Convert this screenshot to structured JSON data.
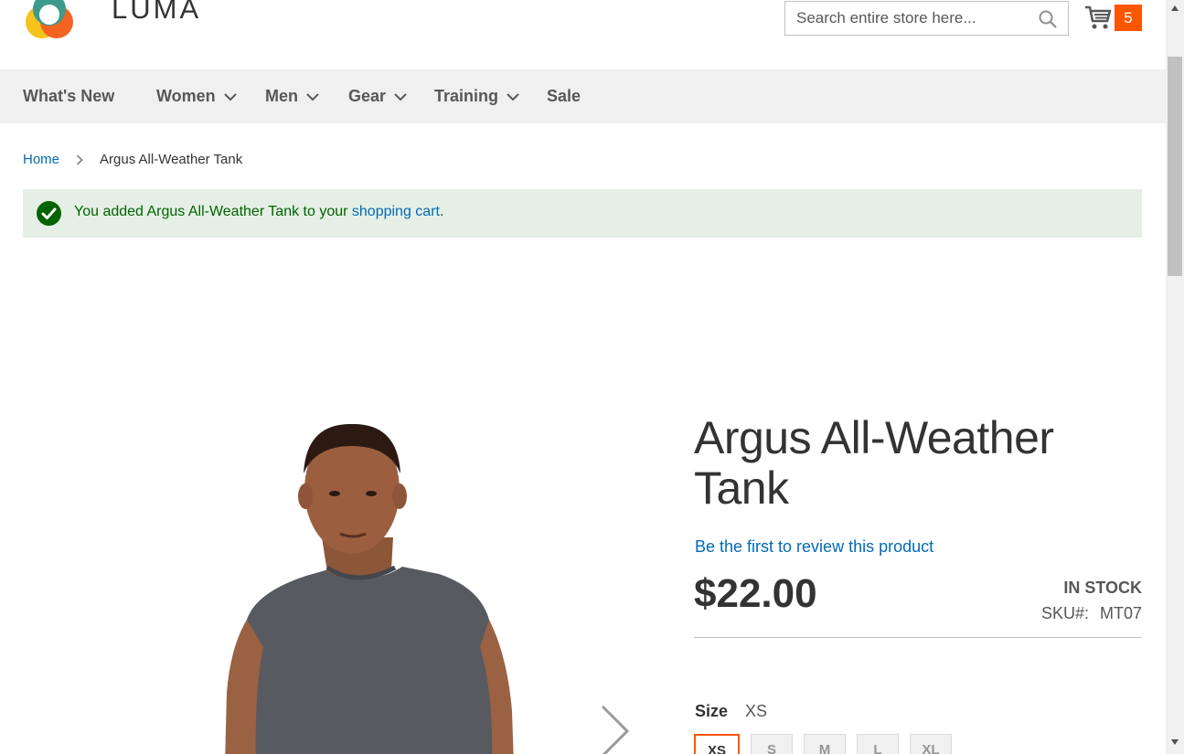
{
  "header": {
    "logo_text": "LUMA",
    "search_placeholder": "Search entire store here...",
    "cart_count": "5"
  },
  "nav": {
    "items": [
      {
        "label": "What's New",
        "has_menu": false
      },
      {
        "label": "Women",
        "has_menu": true
      },
      {
        "label": "Men",
        "has_menu": true
      },
      {
        "label": "Gear",
        "has_menu": true
      },
      {
        "label": "Training",
        "has_menu": true
      },
      {
        "label": "Sale",
        "has_menu": false
      }
    ]
  },
  "breadcrumb": {
    "home": "Home",
    "current": "Argus All-Weather Tank"
  },
  "message": {
    "prefix": "You added Argus All-Weather Tank to your ",
    "link": "shopping cart",
    "suffix": "."
  },
  "product": {
    "title_line1": "Argus All-Weather",
    "title_line2": "Tank",
    "review_link": "Be the first to review this product",
    "price": "$22.00",
    "stock": "IN STOCK",
    "sku_label": "SKU#:",
    "sku": "MT07",
    "size_label": "Size",
    "size_selected": "XS",
    "sizes": [
      "XS",
      "S",
      "M",
      "L",
      "XL"
    ]
  },
  "colors": {
    "accent": "#ff5501",
    "link": "#006bb4",
    "success_bg": "#e5efe5",
    "success_text": "#006400",
    "nav_bg": "#f0f0f0"
  }
}
